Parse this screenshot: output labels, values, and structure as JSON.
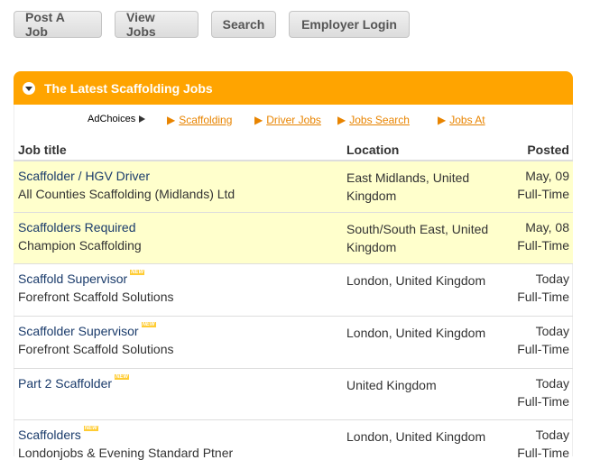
{
  "nav": {
    "buttons": [
      "Post A Job",
      "View Jobs",
      "Search",
      "Employer Login"
    ]
  },
  "panel": {
    "title": "The Latest Scaffolding Jobs"
  },
  "ads": {
    "adchoices": "AdChoices",
    "links": [
      "Scaffolding",
      "Driver Jobs",
      "Jobs Search",
      "Jobs At"
    ],
    "arrow": "▶"
  },
  "table": {
    "headers": {
      "title": "Job title",
      "location": "Location",
      "posted": "Posted"
    },
    "new_label": "NEW",
    "rows": [
      {
        "title": "Scaffolder / HGV Driver",
        "company": "All Counties Scaffolding (Midlands) Ltd",
        "location": "East Midlands, United Kingdom",
        "date": "May, 09",
        "type": "Full-Time",
        "highlight": true,
        "new": false
      },
      {
        "title": "Scaffolders Required",
        "company": "Champion Scaffolding",
        "location": "South/South East, United Kingdom",
        "date": "May, 08",
        "type": "Full-Time",
        "highlight": true,
        "new": false
      },
      {
        "title": "Scaffold Supervisor",
        "company": "Forefront Scaffold Solutions",
        "location": "London, United Kingdom",
        "date": "Today",
        "type": "Full-Time",
        "highlight": false,
        "new": true
      },
      {
        "title": "Scaffolder Supervisor",
        "company": "Forefront Scaffold Solutions",
        "location": "London, United Kingdom",
        "date": "Today",
        "type": "Full-Time",
        "highlight": false,
        "new": true
      },
      {
        "title": "Part 2 Scaffolder",
        "company": "",
        "location": "United Kingdom",
        "date": "Today",
        "type": "Full-Time",
        "highlight": false,
        "new": true
      },
      {
        "title": "Scaffolders",
        "company": "Londonjobs & Evening Standard Ptner",
        "location": "London, United Kingdom",
        "date": "Today",
        "type": "Full-Time",
        "highlight": false,
        "new": true
      }
    ]
  }
}
